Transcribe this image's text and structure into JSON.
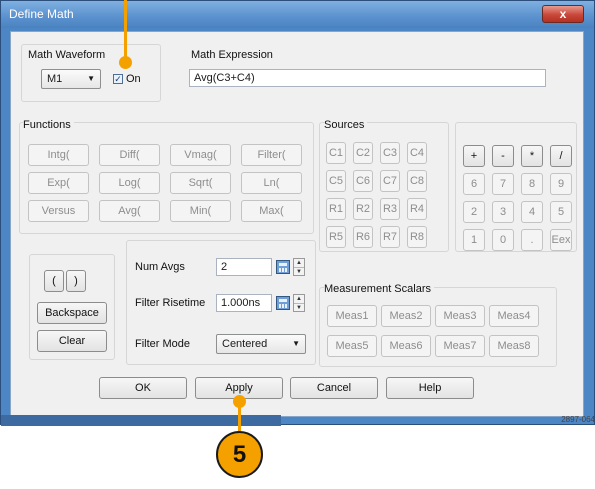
{
  "window": {
    "title": "Define Math",
    "close_label": "x"
  },
  "math_waveform": {
    "label": "Math Waveform",
    "selected": "M1",
    "on_label": "On",
    "on_checked": true
  },
  "math_expression": {
    "label": "Math Expression",
    "value": "Avg(C3+C4)"
  },
  "functions": {
    "label": "Functions",
    "buttons": [
      "Intg(",
      "Diff(",
      "Vmag(",
      "Filter(",
      "Exp(",
      "Log(",
      "Sqrt(",
      "Ln(",
      "Versus",
      "Avg(",
      "Min(",
      "Max("
    ]
  },
  "sources": {
    "label": "Sources",
    "buttons": [
      "C1",
      "C2",
      "C3",
      "C4",
      "C5",
      "C6",
      "C7",
      "C8",
      "R1",
      "R2",
      "R3",
      "R4",
      "R5",
      "R6",
      "R7",
      "R8"
    ]
  },
  "keypad": {
    "buttons": [
      "+",
      "-",
      "*",
      "/",
      "6",
      "7",
      "8",
      "9",
      "2",
      "3",
      "4",
      "5",
      "1",
      "0",
      ".",
      "Eex"
    ]
  },
  "editing": {
    "open_paren": "(",
    "close_paren": ")",
    "backspace": "Backspace",
    "clear": "Clear"
  },
  "settings": {
    "num_avgs_label": "Num Avgs",
    "num_avgs_value": "2",
    "filter_risetime_label": "Filter Risetime",
    "filter_risetime_value": "1.000ns",
    "filter_mode_label": "Filter Mode",
    "filter_mode_value": "Centered"
  },
  "measurement_scalars": {
    "label": "Measurement Scalars",
    "buttons": [
      "Meas1",
      "Meas2",
      "Meas3",
      "Meas4",
      "Meas5",
      "Meas6",
      "Meas7",
      "Meas8"
    ]
  },
  "footer": {
    "ok": "OK",
    "apply": "Apply",
    "cancel": "Cancel",
    "help": "Help"
  },
  "callout": {
    "number": "5",
    "color": "#f4a100"
  },
  "figure_id": "2897-064"
}
